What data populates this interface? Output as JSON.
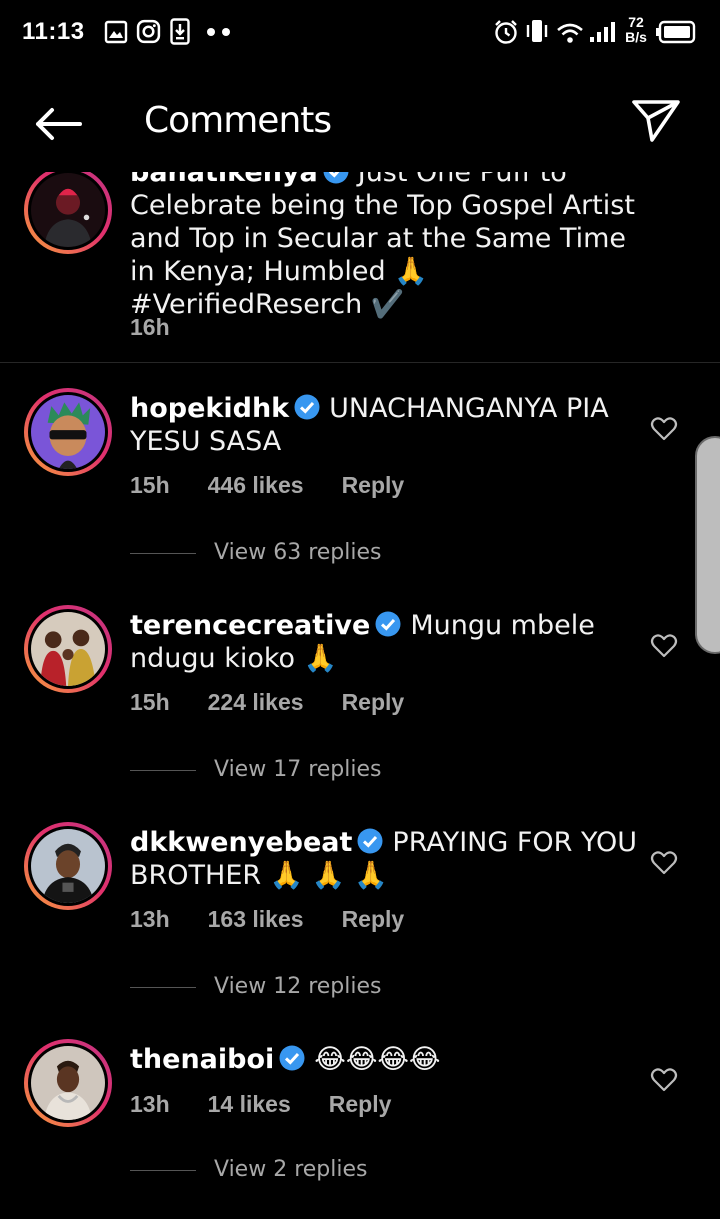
{
  "status_bar": {
    "time": "11:13",
    "net_speed_value": "72",
    "net_speed_unit": "B/s"
  },
  "header": {
    "title": "Comments"
  },
  "caption": {
    "username": "bahatikenya",
    "text": "Just One Puff to Celebrate being the Top Gospel Artist and Top in Secular at the Same Time in Kenya; Humbled 🙏 #VerifiedReserch ✔️",
    "time": "16h"
  },
  "comments": [
    {
      "username": "hopekidhk",
      "text": "UNACHANGANYA PIA YESU SASA",
      "time": "15h",
      "likes": "446 likes",
      "reply": "Reply",
      "view_replies": "View 63 replies"
    },
    {
      "username": "terencecreative",
      "text": "Mungu mbele ndugu kioko 🙏",
      "time": "15h",
      "likes": "224 likes",
      "reply": "Reply",
      "view_replies": "View 17 replies"
    },
    {
      "username": "dkkwenyebeat",
      "text": "PRAYING FOR YOU BROTHER 🙏 🙏 🙏",
      "time": "13h",
      "likes": "163 likes",
      "reply": "Reply",
      "view_replies": "View 12 replies"
    },
    {
      "username": "thenaiboi",
      "text": "😂😂😂😂",
      "time": "13h",
      "likes": "14 likes",
      "reply": "Reply",
      "view_replies": "View 2 replies"
    }
  ],
  "colors": {
    "background": "#000000",
    "verified": "#3897f0",
    "muted": "#a8a8a8",
    "story_ring_start": "#f9a23b",
    "story_ring_end": "#c13584"
  },
  "icons": {
    "back": "arrow-left-icon",
    "send": "paper-plane-icon",
    "like": "heart-outline-icon",
    "verified": "verified-badge-icon"
  }
}
